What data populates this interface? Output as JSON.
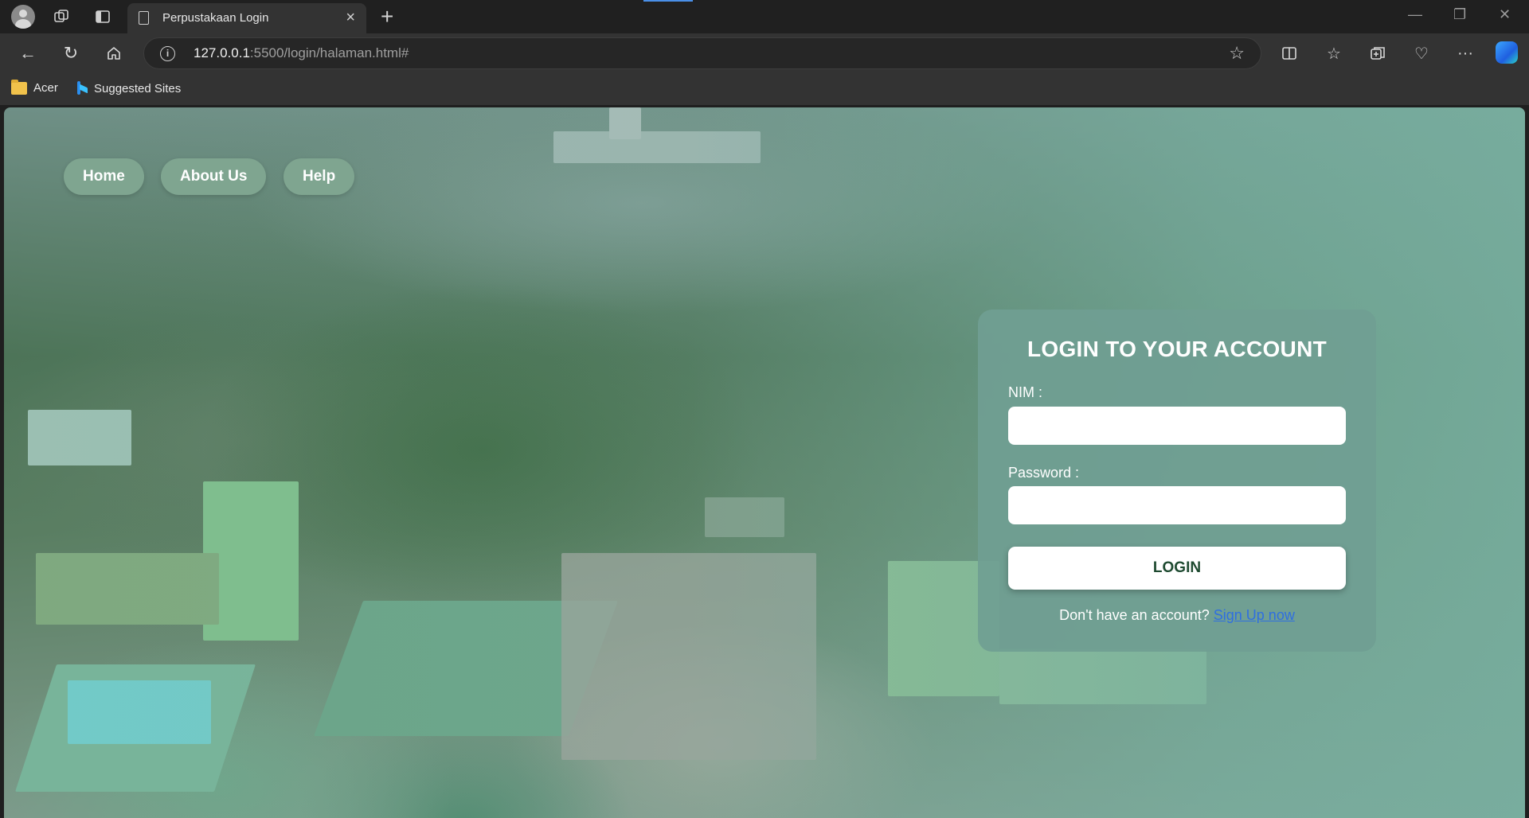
{
  "browser": {
    "tab_title": "Perpustakaan Login",
    "url_host": "127.0.0.1",
    "url_rest": ":5500/login/halaman.html#",
    "bookmarks": [
      {
        "label": "Acer",
        "icon": "folder-icon"
      },
      {
        "label": "Suggested Sites",
        "icon": "bing-icon"
      }
    ]
  },
  "nav": {
    "home": "Home",
    "about": "About Us",
    "help": "Help"
  },
  "login": {
    "title": "LOGIN TO YOUR ACCOUNT",
    "nim_label": "NIM :",
    "nim_value": "",
    "password_label": "Password :",
    "password_value": "",
    "button": "LOGIN",
    "signup_prompt": "Don't have an account?",
    "signup_link": "Sign Up now"
  },
  "colors": {
    "pill": "#7fa590",
    "card": "#709e92",
    "link": "#2f6fe0",
    "button_text": "#1e4a30"
  }
}
